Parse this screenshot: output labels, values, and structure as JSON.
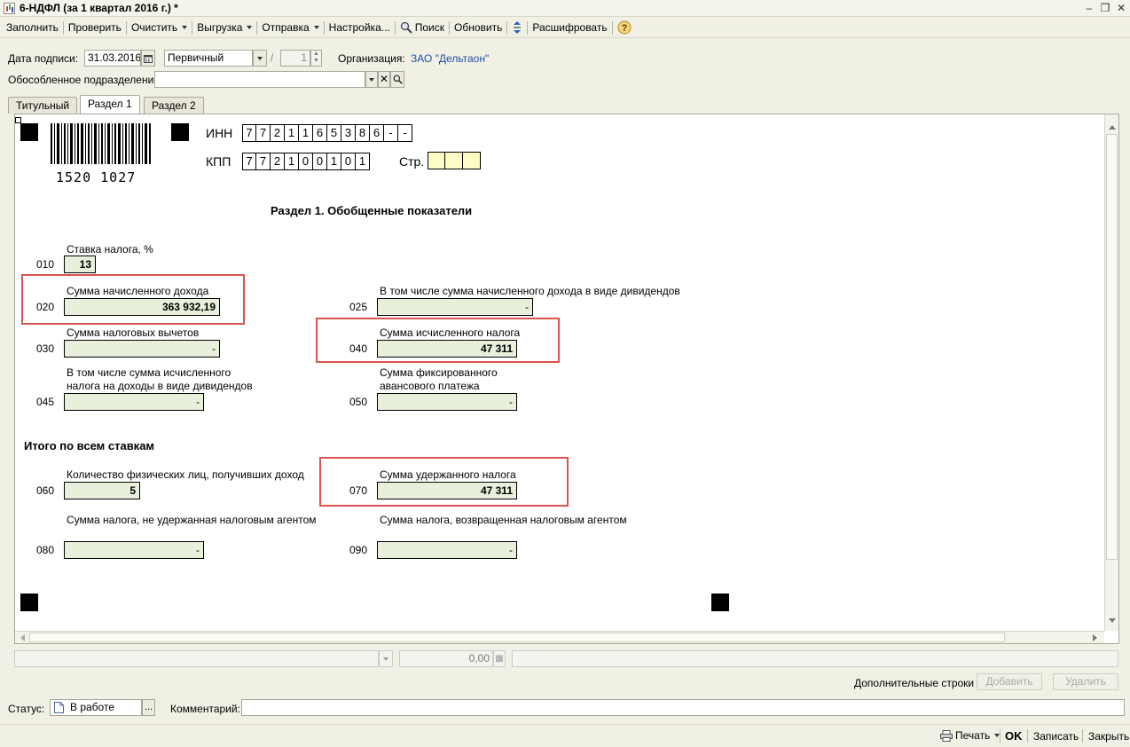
{
  "window": {
    "title": "6-НДФЛ (за 1 квартал 2016 г.) *"
  },
  "toolbar": {
    "fill": "Заполнить",
    "check": "Проверить",
    "clear": "Очистить",
    "export": "Выгрузка",
    "send": "Отправка",
    "settings": "Настройка...",
    "search": "Поиск",
    "refresh": "Обновить",
    "decode": "Расшифровать"
  },
  "header": {
    "sign_date_label": "Дата подписи:",
    "sign_date": "31.03.2016",
    "report_type": "Первичный",
    "slash": "/",
    "correction_number": "1",
    "org_label": "Организация:",
    "org_name": "ЗАО \"Дельтаон\"",
    "subdivision_label": "Обособленное подразделение:",
    "subdivision_value": ""
  },
  "tabs": [
    {
      "label": "Титульный"
    },
    {
      "label": "Раздел 1"
    },
    {
      "label": "Раздел 2"
    }
  ],
  "doc": {
    "barcode": "1520 1027",
    "inn_label": "ИНН",
    "inn_cells": [
      "7",
      "7",
      "2",
      "1",
      "1",
      "6",
      "5",
      "3",
      "8",
      "6",
      "-",
      "-"
    ],
    "kpp_label": "КПП",
    "kpp_cells": [
      "7",
      "7",
      "2",
      "1",
      "0",
      "0",
      "1",
      "0",
      "1"
    ],
    "page_label": "Стр.",
    "page_cells": [
      "",
      "",
      ""
    ],
    "section_title": "Раздел 1. Обобщенные показатели",
    "total_title": "Итого по всем ставкам",
    "fields": {
      "f010": {
        "code": "010",
        "label": "Ставка налога, %",
        "value": "13"
      },
      "f020": {
        "code": "020",
        "label": "Сумма начисленного дохода",
        "value": "363 932,19"
      },
      "f025": {
        "code": "025",
        "label": "В том числе сумма начисленного дохода в виде дивидендов",
        "value": "-"
      },
      "f030": {
        "code": "030",
        "label": "Сумма налоговых вычетов",
        "value": "-"
      },
      "f040": {
        "code": "040",
        "label": "Сумма исчисленного налога",
        "value": "47 311"
      },
      "f045": {
        "code": "045",
        "label1": "В том числе сумма исчисленного",
        "label2": "налога на доходы в виде дивидендов",
        "value": "-"
      },
      "f050": {
        "code": "050",
        "label1": "Сумма фиксированного",
        "label2": "авансового платежа",
        "value": "-"
      },
      "f060": {
        "code": "060",
        "label": "Количество физических лиц, получивших доход",
        "value": "5"
      },
      "f070": {
        "code": "070",
        "label": "Сумма удержанного налога",
        "value": "47 311"
      },
      "f080": {
        "code": "080",
        "label": "Сумма налога, не удержанная налоговым агентом",
        "value": "-"
      },
      "f090": {
        "code": "090",
        "label": "Сумма налога, возвращенная налоговым агентом",
        "value": "-"
      }
    }
  },
  "under_doc": {
    "amount": "0,00",
    "extra_rows_label": "Дополнительные строки",
    "add_button": "Добавить",
    "delete_button": "Удалить"
  },
  "status": {
    "status_label": "Статус:",
    "status_value": "В работе",
    "ellipsis": "...",
    "comment_label": "Комментарий:",
    "comment_value": ""
  },
  "footer": {
    "print": "Печать",
    "ok": "OK",
    "save": "Записать",
    "close": "Закрыть"
  },
  "colors": {
    "highlight_box": "#d9534f",
    "field_bg": "#e8f0dc",
    "page_cell_bg": "#fdfcc4",
    "link": "#1d4fa8"
  }
}
